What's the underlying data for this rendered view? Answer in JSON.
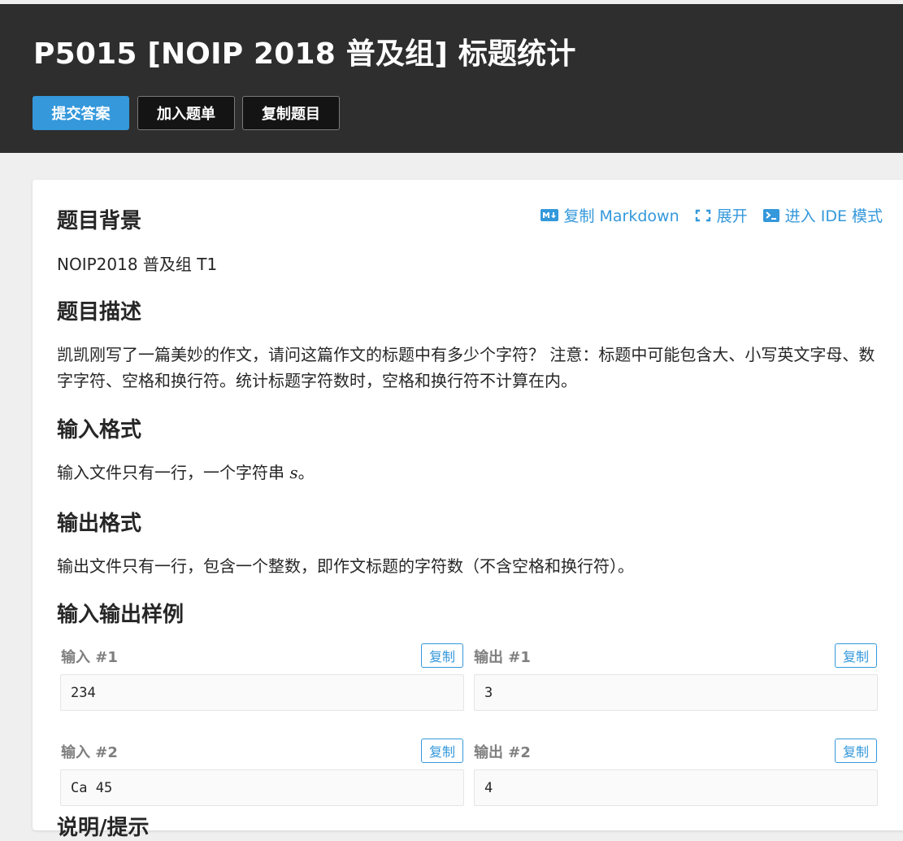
{
  "header": {
    "title": "P5015 [NOIP 2018 普及组] 标题统计",
    "buttons": {
      "submit": "提交答案",
      "add_to_list": "加入题单",
      "copy_problem": "复制题目"
    }
  },
  "toolbar": {
    "copy_markdown": "复制 Markdown",
    "expand": "展开",
    "ide_mode": "进入 IDE 模式"
  },
  "sections": {
    "background": {
      "title": "题目背景",
      "text": "NOIP2018 普及组 T1"
    },
    "description": {
      "title": "题目描述",
      "text": "凯凯刚写了一篇美妙的作文，请问这篇作文的标题中有多少个字符？ 注意：标题中可能包含大、小写英文字母、数字字符、空格和换行符。统计标题字符数时，空格和换行符不计算在内。"
    },
    "input_format": {
      "title": "输入格式",
      "text_before": "输入文件只有一行，一个字符串 ",
      "var": "s",
      "text_after": "。"
    },
    "output_format": {
      "title": "输出格式",
      "text": "输出文件只有一行，包含一个整数，即作文标题的字符数（不含空格和换行符）。"
    },
    "samples": {
      "title": "输入输出样例",
      "copy_label": "复制",
      "items": [
        {
          "input_label": "输入 #1",
          "input": "234",
          "output_label": "输出 #1",
          "output": "3"
        },
        {
          "input_label": "输入 #2",
          "input": "Ca 45",
          "output_label": "输出 #2",
          "output": "4"
        }
      ]
    },
    "partial_next_title": "说明/提示"
  },
  "colors": {
    "header_bg": "#2e2e2e",
    "accent": "#3498db",
    "page_bg": "#efefef"
  },
  "icons": {
    "markdown": "markdown-icon",
    "expand": "expand-icon",
    "ide": "terminal-icon"
  }
}
